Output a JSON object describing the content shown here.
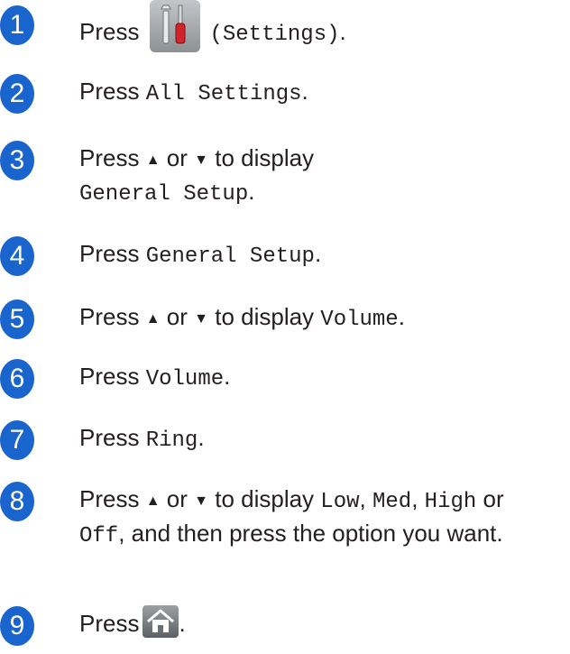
{
  "steps": [
    {
      "n": "1",
      "press": "Press",
      "icon_label": "(Settings)",
      "end": "."
    },
    {
      "n": "2",
      "press": "Press",
      "target": "All Settings",
      "end": "."
    },
    {
      "n": "3",
      "press": "Press",
      "up": "▲",
      "or": "or",
      "down": "▼",
      "display": "to display",
      "target": "General Setup",
      "end": "."
    },
    {
      "n": "4",
      "press": "Press",
      "target": "General Setup",
      "end": "."
    },
    {
      "n": "5",
      "press": "Press",
      "up": "▲",
      "or": "or",
      "down": "▼",
      "display": "to display",
      "target": "Volume",
      "end": "."
    },
    {
      "n": "6",
      "press": "Press",
      "target": "Volume",
      "end": "."
    },
    {
      "n": "7",
      "press": "Press",
      "target": "Ring",
      "end": "."
    },
    {
      "n": "8",
      "press": "Press",
      "up": "▲",
      "or": "or",
      "down": "▼",
      "display": "to display",
      "opt1": "Low",
      "comma1": ",",
      "opt2": "Med",
      "comma2": ",",
      "opt3": "High",
      "or2": "or",
      "opt4": "Off",
      "rest": ", and then press the option you want."
    },
    {
      "n": "9",
      "press": "Press",
      "end": "."
    }
  ],
  "icons": {
    "settings": "settings-icon",
    "home": "home-icon"
  },
  "colors": {
    "step_number_bg": "#1a64ce",
    "settings_icon": "#a4a8ab",
    "home_icon": "#7a7f83"
  }
}
